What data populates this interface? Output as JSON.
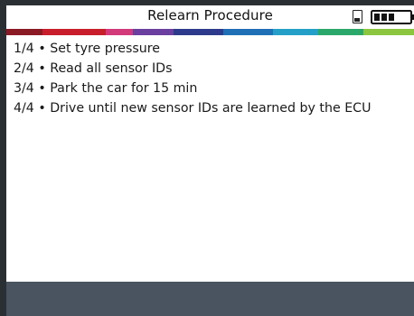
{
  "header": {
    "title": "Relearn Procedure",
    "sd_icon": "sd-card-icon",
    "battery_icon": "battery-icon"
  },
  "steps": [
    "1/4 • Set tyre pressure",
    "2/4 • Read all sensor IDs",
    "3/4 • Park the car for 15 min",
    "4/4 • Drive until new sensor IDs are learned by the ECU"
  ],
  "colors": {
    "frame": "#2a2f33",
    "footer": "#4a5460",
    "strip": [
      "#8a1a24",
      "#c81e2b",
      "#d23a7a",
      "#6b3fa0",
      "#2d3a8c",
      "#1f6fb6",
      "#24a0c8",
      "#2aa86a",
      "#8cc63f"
    ]
  }
}
